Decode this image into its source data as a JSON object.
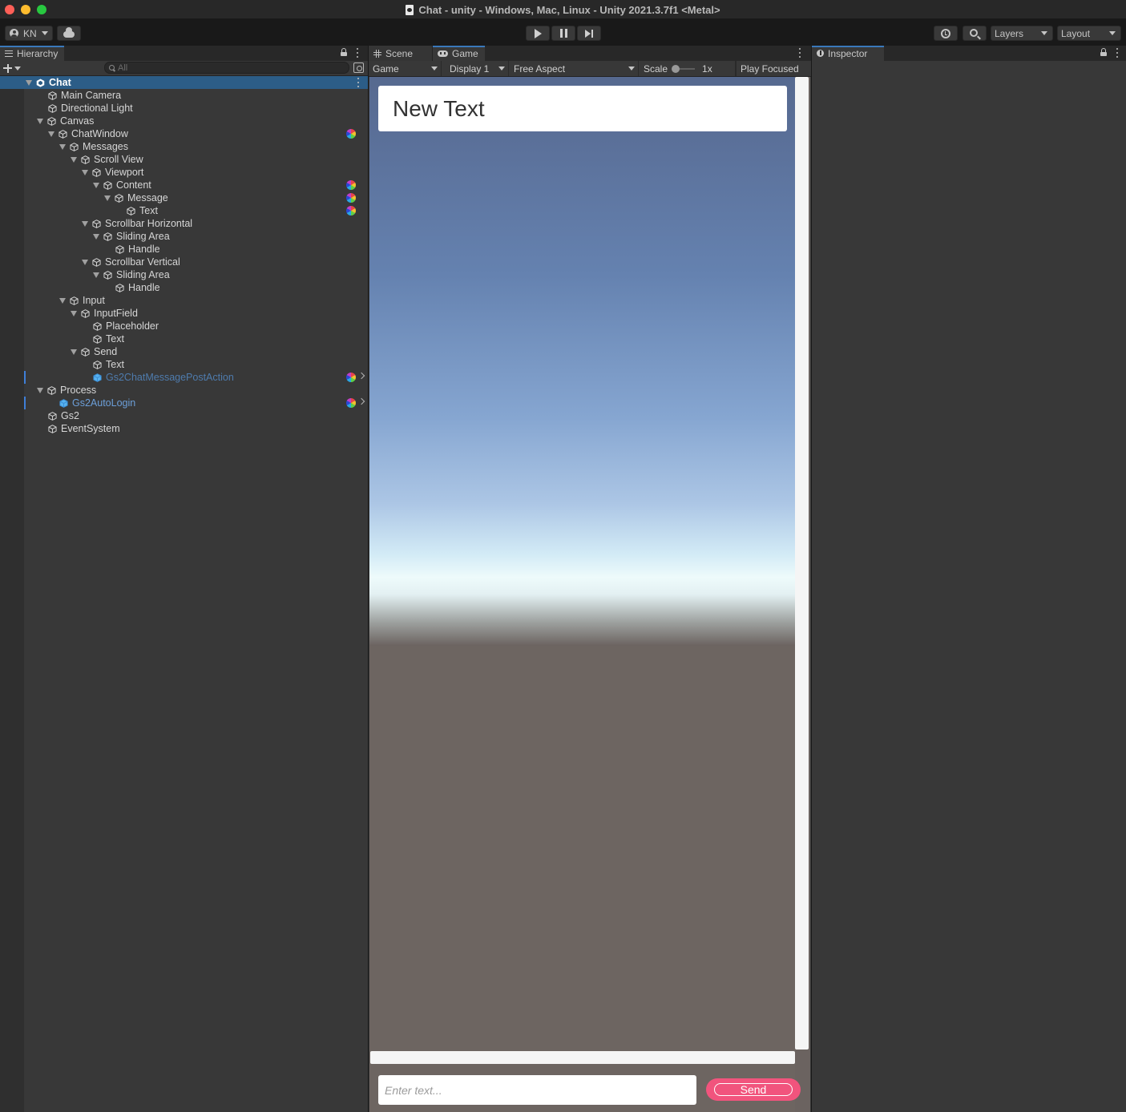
{
  "window": {
    "title": "Chat - unity - Windows, Mac, Linux - Unity 2021.3.7f1 <Metal>"
  },
  "toolbar": {
    "account_label": "KN",
    "layers_label": "Layers",
    "layout_label": "Layout",
    "icons": [
      "account-icon",
      "cloud-icon",
      "play-icon",
      "pause-icon",
      "step-icon",
      "history-icon",
      "search-icon"
    ]
  },
  "hierarchy": {
    "tab_label": "Hierarchy",
    "search_placeholder": "All",
    "items": [
      {
        "label": "Chat",
        "depth": 0,
        "expanded": true,
        "type": "scene"
      },
      {
        "label": "Main Camera",
        "depth": 1,
        "expanded": null
      },
      {
        "label": "Directional Light",
        "depth": 1,
        "expanded": null
      },
      {
        "label": "Canvas",
        "depth": 1,
        "expanded": true
      },
      {
        "label": "ChatWindow",
        "depth": 2,
        "expanded": true,
        "badge": true
      },
      {
        "label": "Messages",
        "depth": 3,
        "expanded": true
      },
      {
        "label": "Scroll View",
        "depth": 4,
        "expanded": true
      },
      {
        "label": "Viewport",
        "depth": 5,
        "expanded": true
      },
      {
        "label": "Content",
        "depth": 6,
        "expanded": true,
        "badge": true
      },
      {
        "label": "Message",
        "depth": 7,
        "expanded": true,
        "badge": true
      },
      {
        "label": "Text",
        "depth": 8,
        "expanded": null,
        "badge": true
      },
      {
        "label": "Scrollbar Horizontal",
        "depth": 5,
        "expanded": true
      },
      {
        "label": "Sliding Area",
        "depth": 6,
        "expanded": true
      },
      {
        "label": "Handle",
        "depth": 7,
        "expanded": null
      },
      {
        "label": "Scrollbar Vertical",
        "depth": 5,
        "expanded": true
      },
      {
        "label": "Sliding Area",
        "depth": 6,
        "expanded": true
      },
      {
        "label": "Handle",
        "depth": 7,
        "expanded": null
      },
      {
        "label": "Input",
        "depth": 3,
        "expanded": true
      },
      {
        "label": "InputField",
        "depth": 4,
        "expanded": true
      },
      {
        "label": "Placeholder",
        "depth": 5,
        "expanded": null
      },
      {
        "label": "Text",
        "depth": 5,
        "expanded": null
      },
      {
        "label": "Send",
        "depth": 4,
        "expanded": true
      },
      {
        "label": "Text",
        "depth": 5,
        "expanded": null
      },
      {
        "label": "Gs2ChatMessagePostAction",
        "depth": 5,
        "expanded": null,
        "type": "prefab-dim",
        "badge": true,
        "chevron": true
      },
      {
        "label": "Process",
        "depth": 1,
        "expanded": true
      },
      {
        "label": "Gs2AutoLogin",
        "depth": 2,
        "expanded": null,
        "type": "prefab",
        "badge": true,
        "chevron": true
      },
      {
        "label": "Gs2",
        "depth": 1,
        "expanded": null
      },
      {
        "label": "EventSystem",
        "depth": 1,
        "expanded": null
      }
    ]
  },
  "game": {
    "tabs": {
      "scene": "Scene",
      "game": "Game"
    },
    "view_select": "Game",
    "display_select": "Display 1",
    "aspect_select": "Free Aspect",
    "scale_label": "Scale",
    "scale_value": "1x",
    "scale_fraction": 0,
    "play_focused": "Play Focused",
    "message_text": "New Text",
    "input_placeholder": "Enter text...",
    "send_label": "Send",
    "colors": {
      "send_button": "#f1547d",
      "ground": "#6d6561",
      "sky_top": "#56698f",
      "horizon": "#eefbfb"
    }
  },
  "inspector": {
    "tab_label": "Inspector"
  }
}
